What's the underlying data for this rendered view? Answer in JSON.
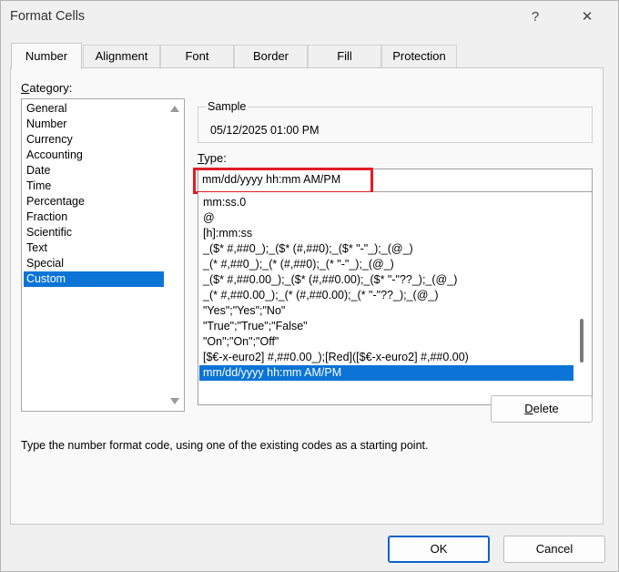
{
  "window": {
    "title": "Format Cells",
    "help_glyph": "?",
    "close_glyph": "✕"
  },
  "tabs": [
    {
      "label": "Number",
      "active": true
    },
    {
      "label": "Alignment",
      "active": false
    },
    {
      "label": "Font",
      "active": false
    },
    {
      "label": "Border",
      "active": false
    },
    {
      "label": "Fill",
      "active": false
    },
    {
      "label": "Protection",
      "active": false
    }
  ],
  "category": {
    "label_accel": "C",
    "label_rest": "ategory:",
    "items": [
      "General",
      "Number",
      "Currency",
      "Accounting",
      "Date",
      "Time",
      "Percentage",
      "Fraction",
      "Scientific",
      "Text",
      "Special",
      "Custom"
    ],
    "selected": "Custom"
  },
  "sample": {
    "label": "Sample",
    "value": "05/12/2025 01:00 PM"
  },
  "type": {
    "label_accel": "T",
    "label_rest": "ype:",
    "value": "mm/dd/yyyy hh:mm AM/PM"
  },
  "formats": {
    "items": [
      "mm:ss.0",
      "@",
      "[h]:mm:ss",
      "_($* #,##0_);_($* (#,##0);_($* \"-\"_);_(@_)",
      "_(* #,##0_);_(* (#,##0);_(* \"-\"_);_(@_)",
      "_($* #,##0.00_);_($* (#,##0.00);_($* \"-\"??_);_(@_)",
      "_(* #,##0.00_);_(* (#,##0.00);_(* \"-\"??_);_(@_)",
      "\"Yes\";\"Yes\";\"No\"",
      "\"True\";\"True\";\"False\"",
      "\"On\";\"On\";\"Off\"",
      "[$€-x-euro2] #,##0.00_);[Red]([$€-x-euro2] #,##0.00)",
      "mm/dd/yyyy hh:mm AM/PM"
    ],
    "selected": "mm/dd/yyyy hh:mm AM/PM"
  },
  "buttons": {
    "delete_accel": "D",
    "delete_rest": "elete",
    "ok": "OK",
    "cancel": "Cancel"
  },
  "hint": "Type the number format code, using one of the existing codes as a starting point.",
  "colors": {
    "selection": "#0b74d6",
    "highlight_border": "#e01c24",
    "primary_border": "#0a62c9"
  }
}
